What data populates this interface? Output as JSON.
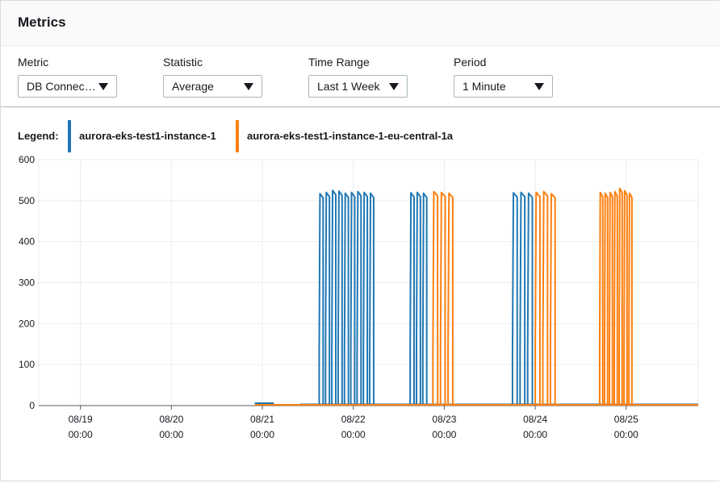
{
  "header": {
    "title": "Metrics"
  },
  "controls": [
    {
      "label": "Metric",
      "value": "DB Connec…"
    },
    {
      "label": "Statistic",
      "value": "Average"
    },
    {
      "label": "Time Range",
      "value": "Last 1 Week"
    },
    {
      "label": "Period",
      "value": "1 Minute"
    }
  ],
  "legend": {
    "title": "Legend:",
    "items": [
      {
        "name": "aurora-eks-test1-instance-1",
        "color": "#1f77b4"
      },
      {
        "name": "aurora-eks-test1-instance-1-eu-central-1a",
        "color": "#ff7f0e"
      }
    ]
  },
  "chart_data": {
    "type": "line",
    "xlim": [
      "08/18 13:00",
      "08/25 19:00"
    ],
    "ylim": [
      0,
      600
    ],
    "y_ticks": [
      0,
      100,
      200,
      300,
      400,
      500,
      600
    ],
    "x_ticks": [
      {
        "date": "08/19",
        "time": "00:00"
      },
      {
        "date": "08/20",
        "time": "00:00"
      },
      {
        "date": "08/21",
        "time": "00:00"
      },
      {
        "date": "08/22",
        "time": "00:00"
      },
      {
        "date": "08/23",
        "time": "00:00"
      },
      {
        "date": "08/24",
        "time": "00:00"
      },
      {
        "date": "08/25",
        "time": "00:00"
      }
    ],
    "grid": true,
    "series": [
      {
        "name": "aurora-eks-test1-instance-1",
        "color": "#1f77b4",
        "baseline": [
          {
            "from": "08/20 22:00",
            "to": "08/21 03:00",
            "value": 6
          },
          {
            "from": "08/21 03:00",
            "to": "08/21 10:00",
            "value": 2
          },
          {
            "from": "08/21 10:00",
            "to": "08/25 19:00",
            "value": 3
          }
        ],
        "bursts": [
          {
            "start": "08/21 15:00",
            "end": "08/22 06:00",
            "peaks": [
              517,
              520,
              525,
              523,
              518,
              520,
              522,
              520,
              518
            ]
          },
          {
            "start": "08/22 15:00",
            "end": "08/22 20:00",
            "peaks": [
              519,
              520,
              518
            ]
          },
          {
            "start": "08/23 18:00",
            "end": "08/24 00:00",
            "peaks": [
              519,
              520,
              518
            ]
          }
        ]
      },
      {
        "name": "aurora-eks-test1-instance-1-eu-central-1a",
        "color": "#ff7f0e",
        "baseline": [
          {
            "from": "08/20 22:00",
            "to": "08/25 19:00",
            "value": 2
          }
        ],
        "bursts": [
          {
            "start": "08/22 21:00",
            "end": "08/23 03:00",
            "peaks": [
              522,
              520,
              518
            ]
          },
          {
            "start": "08/24 00:00",
            "end": "08/24 06:00",
            "peaks": [
              520,
              522,
              517
            ]
          },
          {
            "start": "08/24 17:00",
            "end": "08/25 02:00",
            "peaks": [
              520,
              518,
              520,
              522,
              530,
              524,
              518
            ]
          }
        ]
      }
    ]
  }
}
